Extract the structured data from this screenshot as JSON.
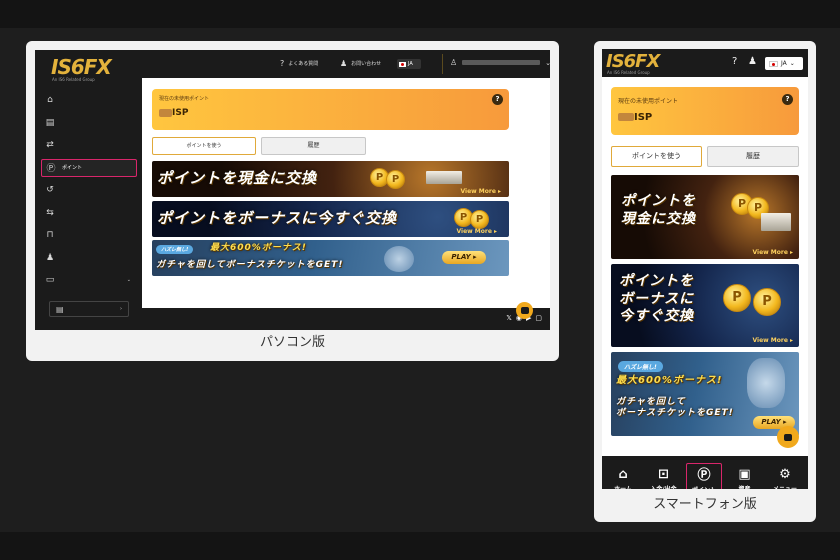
{
  "captions": {
    "pc": "パソコン版",
    "sp": "スマートフォン版"
  },
  "brand": {
    "logo": "IS6FX",
    "tagline": "An IS6 Related Group"
  },
  "pc": {
    "header": {
      "faq": "よくある質問",
      "contact": "お問い合わせ",
      "lang": "JA"
    },
    "sidebar": [
      {
        "icon": "home-icon",
        "glyph": "⌂",
        "label": ""
      },
      {
        "icon": "assets-icon",
        "glyph": "▤",
        "label": ""
      },
      {
        "icon": "deposit-withdraw-icon",
        "glyph": "⇄",
        "label": ""
      },
      {
        "icon": "point-icon",
        "glyph": "Ⓟ",
        "label": "ポイント"
      },
      {
        "icon": "history-icon",
        "glyph": "↺",
        "label": ""
      },
      {
        "icon": "fund-transfer-icon",
        "glyph": "⇆",
        "label": ""
      },
      {
        "icon": "bank-icon",
        "glyph": "⊓",
        "label": ""
      },
      {
        "icon": "referral-icon",
        "glyph": "♟",
        "label": ""
      },
      {
        "icon": "platform-icon",
        "glyph": "▭",
        "label": ""
      }
    ],
    "terms": "",
    "points": {
      "label": "現在の未使用ポイント",
      "unit": "ISP"
    },
    "tabs": {
      "use": "ポイントを使う",
      "history": "履歴"
    },
    "banner1": "ポイントを現金に交換",
    "banner2": "ポイントをボーナスに今すぐ交換",
    "view_more": "View More ▸",
    "banner3": {
      "badge": "ハズレ無し!",
      "headline": "最大600%ボーナス!",
      "sub": "ガチャを回してボーナスチケットをGET!",
      "play": "PLAY ▸"
    },
    "social": [
      "X",
      "telegram",
      "youtube",
      "app"
    ]
  },
  "sp": {
    "lang": "JA",
    "points": {
      "label": "現在の未使用ポイント",
      "unit": "ISP"
    },
    "tabs": {
      "use": "ポイントを使う",
      "history": "履歴"
    },
    "banner1": "ポイントを\n現金に交換",
    "banner2": "ポイントを\nボーナスに\n今すぐ交換",
    "view_more": "View More ▸",
    "banner3": {
      "badge": "ハズレ無し!",
      "headline": "最大600%ボーナス!",
      "sub": "ガチャを回して\nボーナスチケットをGET!",
      "play": "PLAY ▸"
    },
    "bottom_nav": [
      {
        "icon": "home-icon",
        "glyph": "⌂",
        "label": "ホーム"
      },
      {
        "icon": "deposit-withdraw-icon",
        "glyph": "⊡",
        "label": "入金/出金"
      },
      {
        "icon": "point-icon",
        "glyph": "Ⓟ",
        "label": "ポイント"
      },
      {
        "icon": "wallet-icon",
        "glyph": "▣",
        "label": "資産"
      },
      {
        "icon": "settings-icon",
        "glyph": "⚙",
        "label": "メニュー"
      }
    ]
  },
  "colors": {
    "accent": "#f5a623",
    "highlight": "#d9266b",
    "sidebar": "#1b1b1b"
  }
}
